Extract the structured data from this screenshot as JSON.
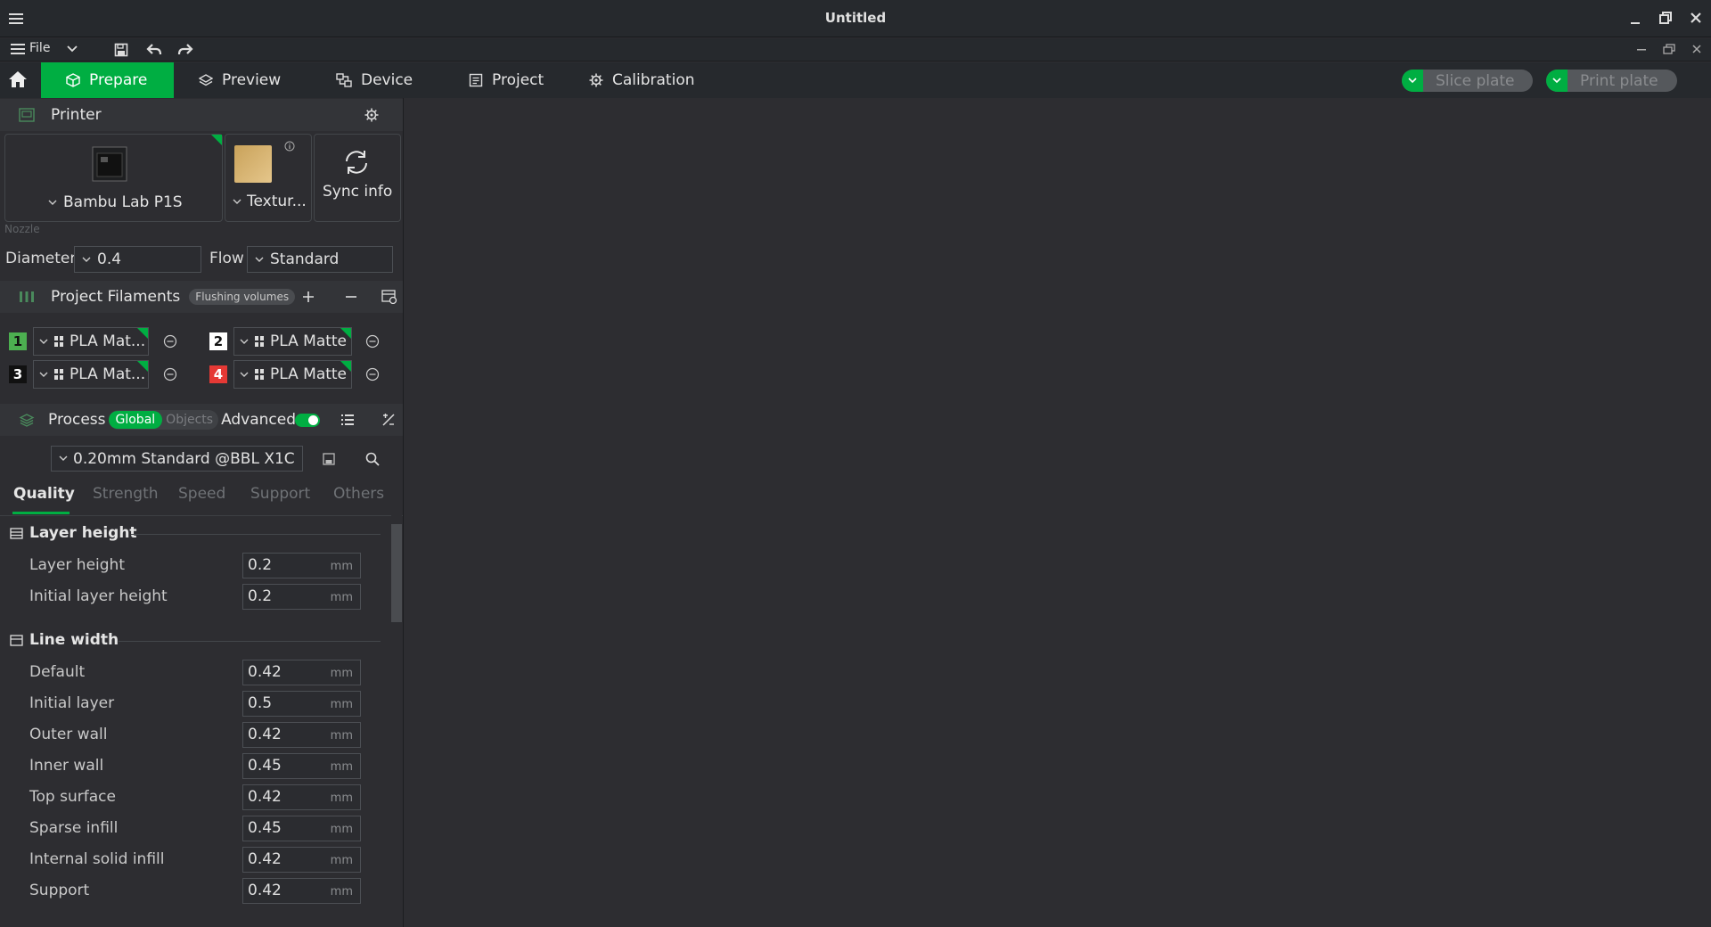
{
  "window": {
    "title": "Untitled"
  },
  "menu": {
    "file_label": "File"
  },
  "tabs": [
    {
      "label": "Prepare",
      "icon": "cube-icon"
    },
    {
      "label": "Preview",
      "icon": "layers-icon"
    },
    {
      "label": "Device",
      "icon": "device-icon"
    },
    {
      "label": "Project",
      "icon": "document-icon"
    },
    {
      "label": "Calibration",
      "icon": "gear-icon"
    }
  ],
  "actions": {
    "slice_label": "Slice plate",
    "print_label": "Print plate"
  },
  "printer": {
    "section_title": "Printer",
    "name": "Bambu Lab P1S",
    "plate": "Textur...",
    "sync_label": "Sync info",
    "nozzle_label": "Nozzle",
    "diameter_label": "Diameter",
    "diameter_value": "0.4",
    "flow_label": "Flow",
    "flow_value": "Standard"
  },
  "filaments": {
    "section_title": "Project Filaments",
    "flushing_label": "Flushing volumes",
    "items": [
      {
        "num": "1",
        "name": "PLA Mat...",
        "color": "#4caf50",
        "numcolor": "#111111"
      },
      {
        "num": "2",
        "name": "PLA Matte",
        "color": "#ffffff",
        "numcolor": "#111111"
      },
      {
        "num": "3",
        "name": "PLA Mat...",
        "color": "#111111",
        "numcolor": "#ffffff"
      },
      {
        "num": "4",
        "name": "PLA Matte",
        "color": "#e53935",
        "numcolor": "#ffffff"
      }
    ]
  },
  "process": {
    "section_title": "Process",
    "global_label": "Global",
    "objects_label": "Objects",
    "advanced_label": "Advanced",
    "preset": "0.20mm Standard @BBL X1C",
    "subtabs": [
      "Quality",
      "Strength",
      "Speed",
      "Support",
      "Others"
    ],
    "groups": [
      {
        "title": "Layer height",
        "rows": [
          {
            "label": "Layer height",
            "value": "0.2",
            "unit": "mm"
          },
          {
            "label": "Initial layer height",
            "value": "0.2",
            "unit": "mm"
          }
        ]
      },
      {
        "title": "Line width",
        "rows": [
          {
            "label": "Default",
            "value": "0.42",
            "unit": "mm"
          },
          {
            "label": "Initial layer",
            "value": "0.5",
            "unit": "mm"
          },
          {
            "label": "Outer wall",
            "value": "0.42",
            "unit": "mm"
          },
          {
            "label": "Inner wall",
            "value": "0.45",
            "unit": "mm"
          },
          {
            "label": "Top surface",
            "value": "0.42",
            "unit": "mm"
          },
          {
            "label": "Sparse infill",
            "value": "0.45",
            "unit": "mm"
          },
          {
            "label": "Internal solid infill",
            "value": "0.42",
            "unit": "mm"
          },
          {
            "label": "Support",
            "value": "0.42",
            "unit": "mm"
          }
        ]
      }
    ]
  },
  "colors": {
    "accent": "#00ae42",
    "background": "#2d2d31",
    "bar": "#26292d"
  }
}
